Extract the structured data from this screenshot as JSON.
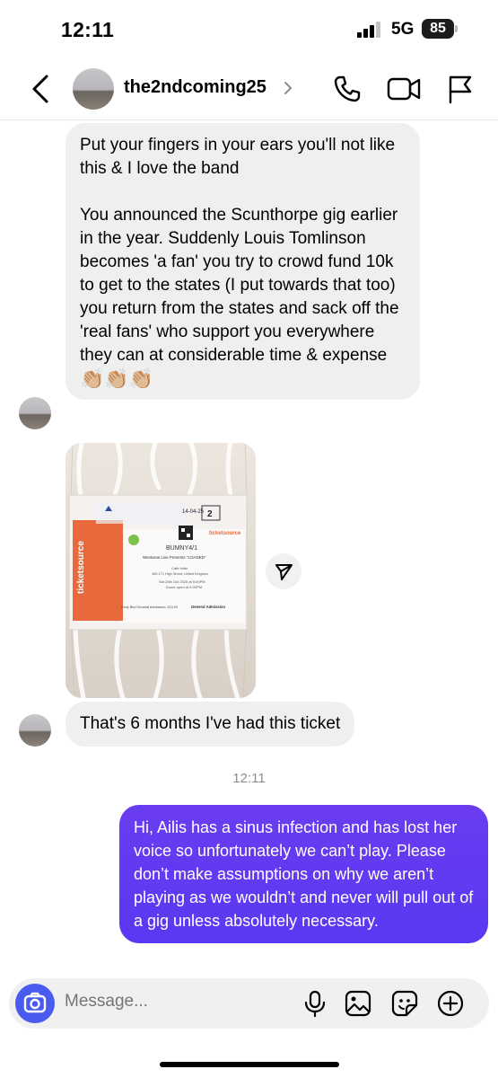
{
  "status": {
    "time": "12:11",
    "network": "5G",
    "battery": "85"
  },
  "header": {
    "username": "the2ndcoming25"
  },
  "messages": {
    "m1_p1": "Put your fingers in your ears you'll not like this & I love the band",
    "m1_p2": "You announced the Scunthorpe gig earlier in the year. Suddenly Louis Tomlinson becomes 'a fan' you try to crowd fund 10k to get to the states (I put towards that too) you return from the states and sack off the 'real fans' who support you everywhere they can at considerable time & expense",
    "m1_emoji": "👏🏼👏🏼👏🏼",
    "m2": "That's 6 months I've had this ticket",
    "timestamp": "12:11",
    "m3": "Hi, Ailis has a sinus infection and has lost her voice so unfortunately we can’t play. Please don’t make assumptions on why we aren’t playing as we wouldn’t and never will pull out of a gig unless absolutely necessary."
  },
  "ticket": {
    "brand": "ticketsource",
    "code": "BUMNY4/1",
    "event": "Westview Live Presents \"LOADED\"",
    "venue": "Cafe Indie",
    "address": "169-171 High Street, United Kingdom",
    "date": "Sat 25th Oct 2025 at 5:00PM",
    "doors": "Doors open at 4:00PM",
    "type": "Early Bird General Admission: £10.00",
    "category": "General Admission",
    "postmark": "14-04-25",
    "box": "2"
  },
  "composer": {
    "placeholder": "Message..."
  },
  "icons": {
    "back": "chevron-left-icon",
    "call": "phone-icon",
    "video": "video-camera-icon",
    "flag": "flag-icon",
    "share": "send-icon",
    "camera": "camera-icon",
    "mic": "microphone-icon",
    "gallery": "image-icon",
    "sticker": "sticker-icon",
    "add": "plus-circle-icon"
  },
  "colors": {
    "outgoing": "#5a38f3",
    "incoming": "#efefef",
    "camera": "#4a5bf0"
  }
}
